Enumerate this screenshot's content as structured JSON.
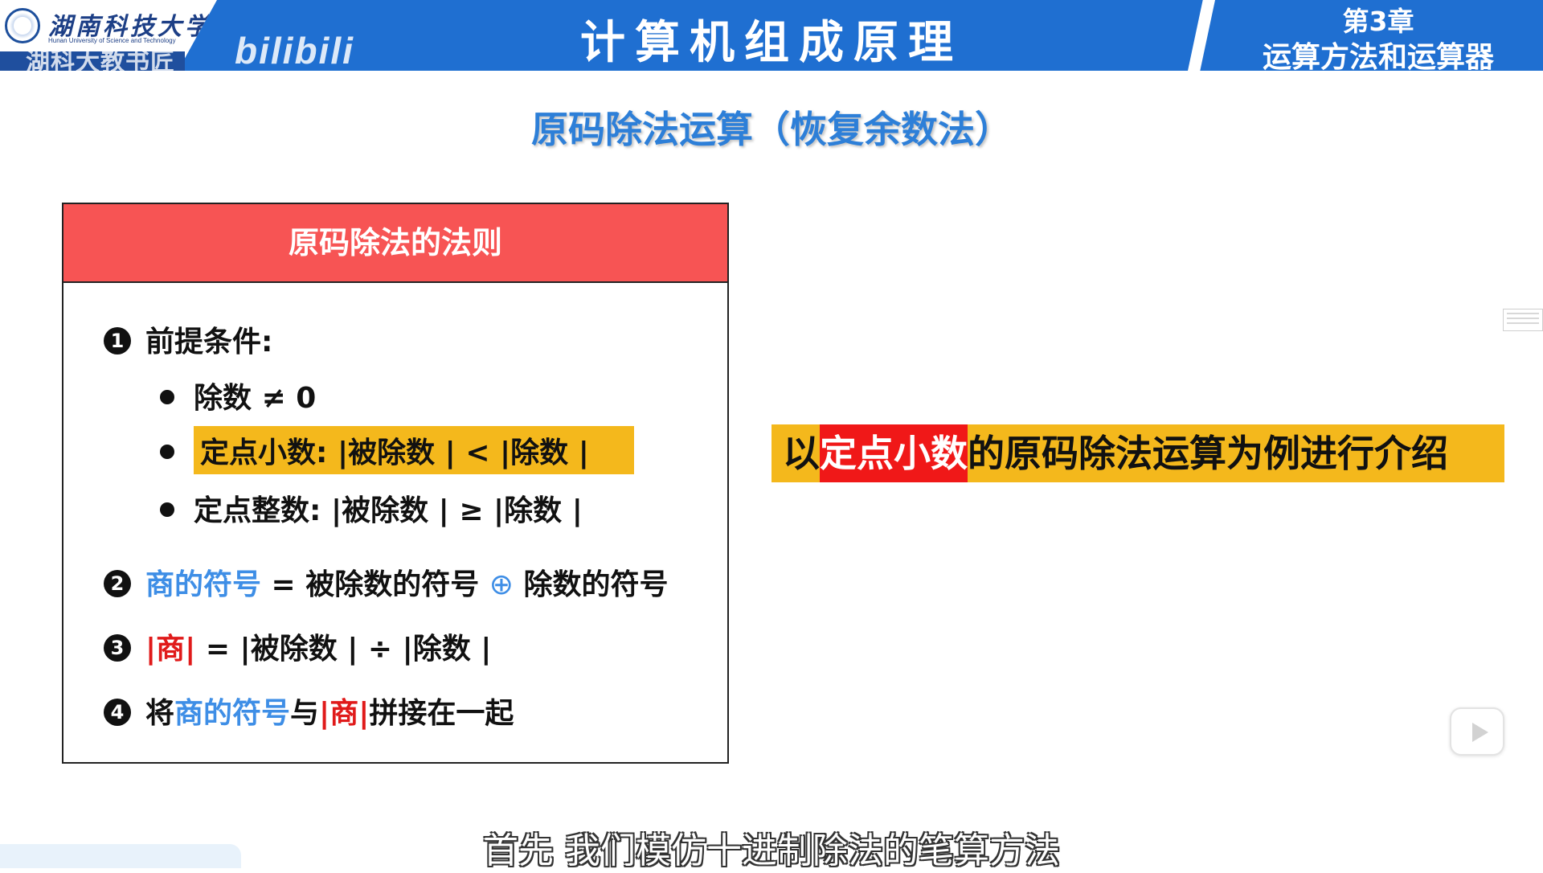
{
  "header": {
    "university_name": "湖南科技大学",
    "university_en": "Hunan University of Science and Technology",
    "watermark": "湖科大教书匠",
    "bilibili_logo": "bilibili",
    "course_title": "计算机组成原理",
    "chapter_number": "第3章",
    "chapter_name": "运算方法和运算器"
  },
  "slide": {
    "title": "原码除法运算（恢复余数法）",
    "rules_box": {
      "heading": "原码除法的法则",
      "rule1": {
        "marker": "1",
        "label": "前提条件:",
        "conditions": [
          {
            "text": "除数 ≠ 0"
          },
          {
            "a": "定点小数:",
            "b": "|被除数 | < |除数 |"
          },
          {
            "a": "定点整数:",
            "b": "|被除数 | ≥ |除数 |"
          }
        ]
      },
      "rule2": {
        "marker": "2",
        "part1": "商的符号",
        "part2": " = 被除数的符号",
        "op": "⊕",
        "part3": "除数的符号"
      },
      "rule3": {
        "marker": "3",
        "part1": "|商|",
        "part2": " = |被除数 | ÷ |除数 |"
      },
      "rule4": {
        "marker": "4",
        "part1": "将",
        "part2": "商的符号",
        "part3": "与",
        "part4": "|商|",
        "part5": "拼接在一起"
      }
    },
    "callout": {
      "prefix": "以",
      "highlight": "定点小数",
      "suffix": "的原码除法运算为例进行介绍"
    }
  },
  "subtitle": "首先 我们模仿十进制除法的笔算方法",
  "colors": {
    "header_blue": "#1f6fd1",
    "title_blue": "#2d7fd8",
    "rules_header_red": "#f75454",
    "highlight_yellow": "#f4b81c",
    "accent_blue": "#3e8ee6",
    "accent_red": "#e01a1a"
  },
  "icons": [
    "university-seal-icon",
    "play-icon"
  ]
}
